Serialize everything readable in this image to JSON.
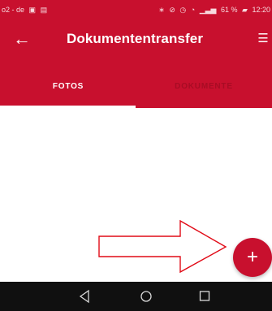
{
  "status_bar": {
    "carrier": "o2 - de",
    "battery_percent": "61 %",
    "time": "12:20",
    "icons": {
      "left": [
        "notification-icon",
        "store-icon"
      ],
      "right": [
        "bluetooth-icon",
        "mute-icon",
        "alarm-icon",
        "wifi-icon",
        "signal-icon",
        "battery-icon"
      ]
    }
  },
  "header": {
    "title": "Dokumententransfer",
    "icons": {
      "back": "arrow-left-icon",
      "menu": "menu-icon"
    }
  },
  "tabs": [
    {
      "label": "FOTOS",
      "active": true
    },
    {
      "label": "DOKUMENTE",
      "active": false
    }
  ],
  "floating_action_button": {
    "label": "+"
  },
  "navigation_bar": {
    "icons": [
      "back-icon",
      "home-icon",
      "recents-icon"
    ]
  },
  "colors": {
    "brand": "#c8102e",
    "background": "#ffffff",
    "annotation": "#e10b17",
    "navigation_bar": "#101010"
  }
}
